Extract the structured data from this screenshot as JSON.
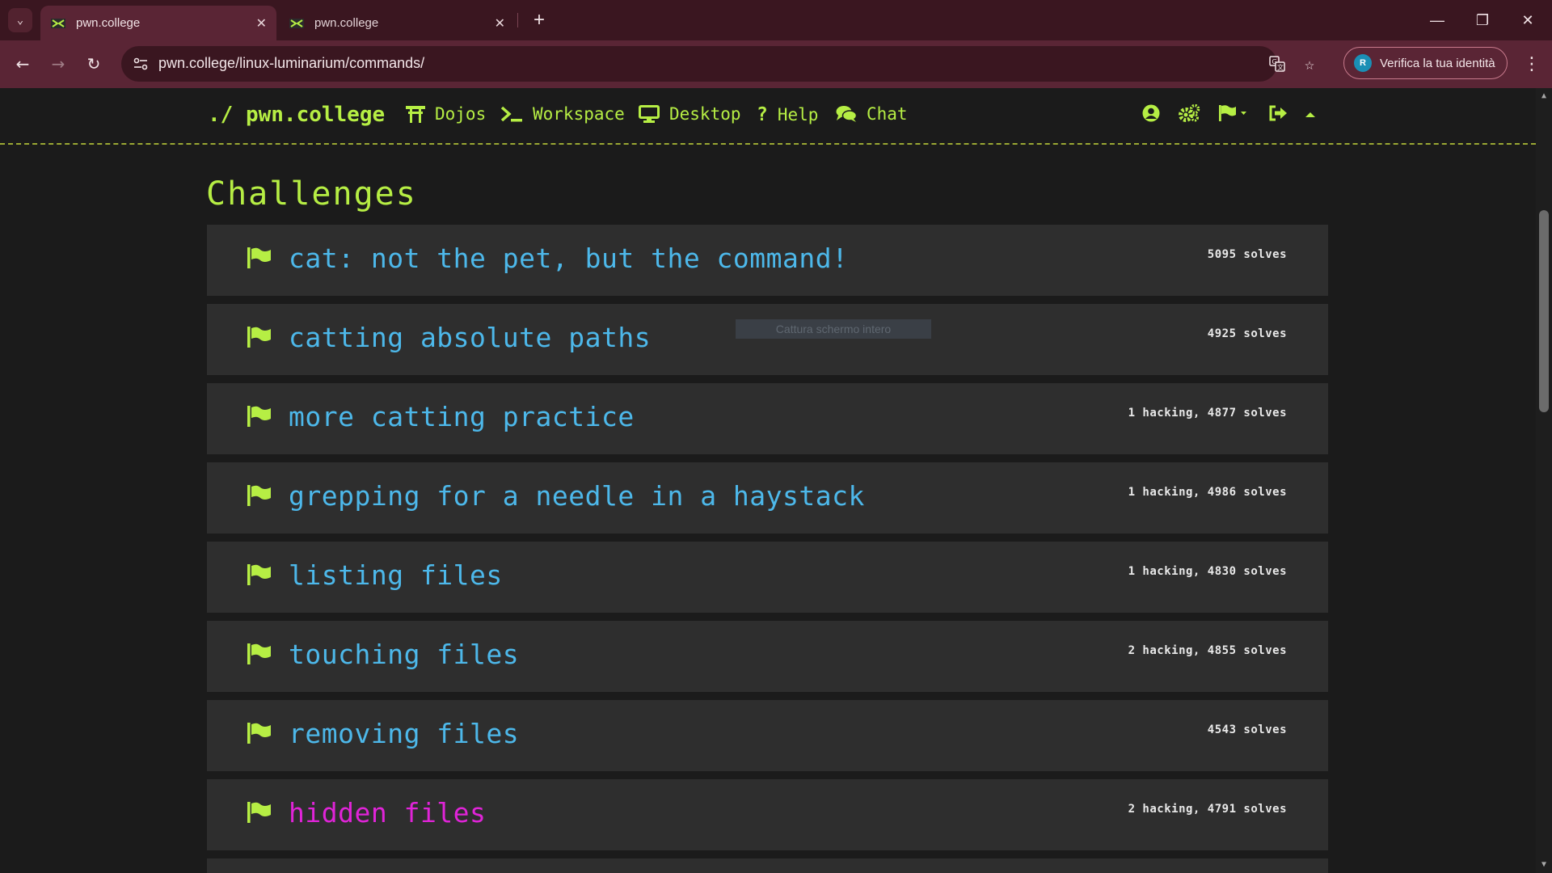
{
  "browser": {
    "tabs": [
      {
        "title": "pwn.college",
        "active": true
      },
      {
        "title": "pwn.college",
        "active": false
      }
    ],
    "new_tab": "+",
    "window_controls": {
      "minimize": "—",
      "restore": "❐",
      "close": "✕"
    },
    "url": "pwn.college/linux-luminarium/commands/",
    "profile_label": "Verifica la tua identità",
    "profile_initial": "R"
  },
  "site": {
    "brand": "./ pwn.college",
    "nav": [
      {
        "label": "Dojos",
        "icon": "torii-gate-icon"
      },
      {
        "label": "Workspace",
        "icon": "terminal-icon"
      },
      {
        "label": "Desktop",
        "icon": "desktop-icon"
      },
      {
        "label": "Help",
        "icon": "question-icon"
      },
      {
        "label": "Chat",
        "icon": "comments-icon"
      }
    ],
    "nav_right_icons": [
      "user-circle-icon",
      "cogs-icon",
      "flag-dropdown-icon",
      "sign-out-icon",
      "caret-up-icon"
    ]
  },
  "main": {
    "heading": "Challenges",
    "challenges": [
      {
        "name": "cat: not the pet, but the command!",
        "stats": "5095 solves"
      },
      {
        "name": "catting absolute paths",
        "stats": "4925 solves"
      },
      {
        "name": "more catting practice",
        "stats": "1 hacking, 4877 solves"
      },
      {
        "name": "grepping for a needle in a haystack",
        "stats": "1 hacking, 4986 solves"
      },
      {
        "name": "listing files",
        "stats": "1 hacking, 4830 solves"
      },
      {
        "name": "touching files",
        "stats": "2 hacking, 4855 solves"
      },
      {
        "name": "removing files",
        "stats": "4543 solves"
      },
      {
        "name": "hidden files",
        "stats": "2 hacking, 4791 solves"
      }
    ],
    "overlay_tooltip": "Cattura schermo intero"
  },
  "colors": {
    "accent_green": "#b6ee44",
    "link_blue": "#4db8ea",
    "highlight_magenta": "#e024d8",
    "card_bg": "#2e2e2e",
    "chrome_bg": "#5a2535"
  }
}
